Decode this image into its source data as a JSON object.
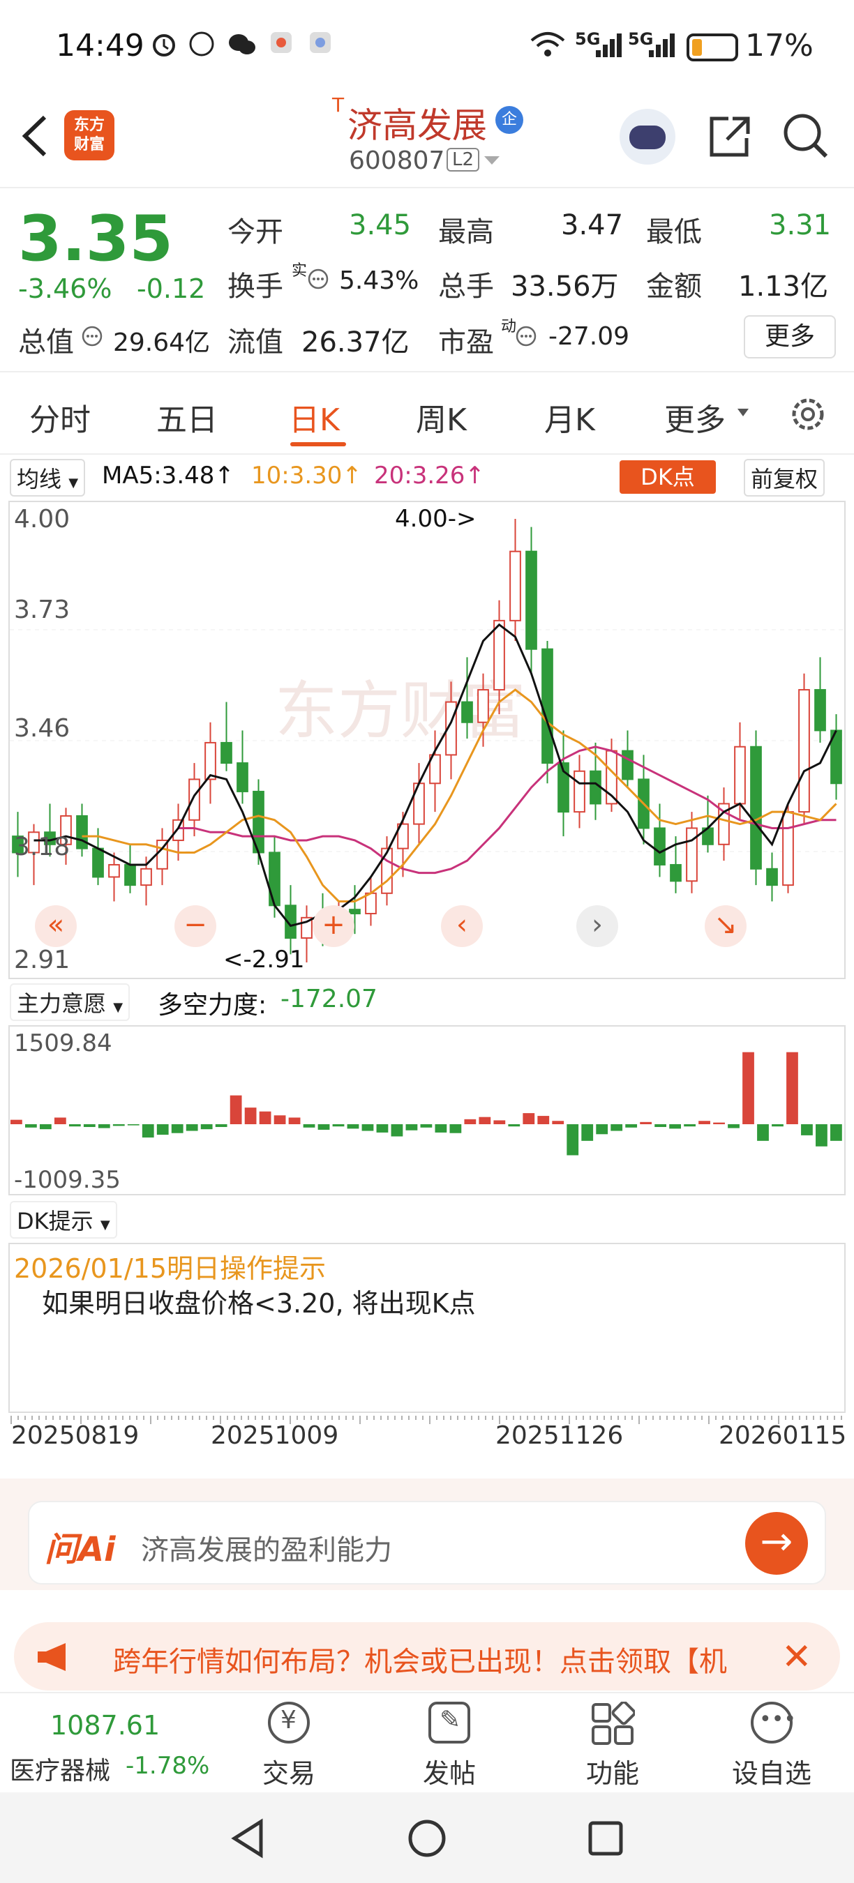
{
  "status_bar": {
    "time": "14:49",
    "battery": "17%",
    "net1": "5G",
    "net2": "5G"
  },
  "header": {
    "logo_line1": "东方",
    "logo_line2": "财富",
    "stock_name": "济高发展",
    "name_prefix": "T",
    "badge": "企",
    "code": "600807",
    "level": "L2"
  },
  "quote": {
    "price": "3.35",
    "change_pct": "-3.46%",
    "change_amt": "-0.12",
    "labels": {
      "open": "今开",
      "high": "最高",
      "low": "最低",
      "turnover": "换手",
      "turnover_sup": "实",
      "volume": "总手",
      "amount": "金额",
      "mktcap": "总值",
      "float": "流值",
      "pe": "市盈",
      "pe_sup": "动"
    },
    "values": {
      "open": "3.45",
      "high": "3.47",
      "low": "3.31",
      "turnover": "5.43%",
      "volume": "33.56万",
      "amount": "1.13亿",
      "mktcap": "29.64亿",
      "float": "26.37亿",
      "pe": "-27.09"
    },
    "more": "更多"
  },
  "tabs": [
    "分时",
    "五日",
    "日K",
    "周K",
    "月K",
    "更多"
  ],
  "active_tab": "日K",
  "ma_bar": {
    "selector": "均线",
    "ma5": "MA5:3.48↑",
    "ma10": "10:3.30↑",
    "ma20": "20:3.26↑",
    "dk": "DK点",
    "adj": "前复权"
  },
  "kline": {
    "y_ticks": [
      "4.00",
      "3.73",
      "3.46",
      "3.18",
      "2.91"
    ],
    "max_label": "4.00->",
    "min_label": "<-2.91",
    "watermark": "东方财富"
  },
  "sub_indicator": {
    "selector": "主力意愿",
    "label": "多空力度:",
    "value": "-172.07",
    "top": "1509.84",
    "bottom": "-1009.35"
  },
  "dk_hint": {
    "selector": "DK提示",
    "date_title": "2026/01/15明日操作提示",
    "text": "如果明日收盘价格<3.20, 将出现K点"
  },
  "dates": [
    "20250819",
    "20251009",
    "20251126",
    "20260115"
  ],
  "ai": {
    "logo": "问Ai",
    "placeholder": "济高发展的盈利能力"
  },
  "ad": {
    "text": "跨年行情如何布局？机会或已出现！点击领取【机"
  },
  "bottom_nav": {
    "index_value": "1087.61",
    "index_name": "医疗器械",
    "index_change": "-1.78%",
    "items": [
      "交易",
      "发帖",
      "功能",
      "设自选"
    ]
  },
  "colors": {
    "up": "#d9453a",
    "down": "#2f9a3a",
    "accent": "#e8541e",
    "ma5": "#111111",
    "ma10": "#e8961e",
    "ma20": "#c8327a"
  },
  "chart_data": {
    "type": "candlestick",
    "y_range": [
      2.91,
      4.0
    ],
    "ohlc": [
      [
        3.22,
        3.28,
        3.12,
        3.18
      ],
      [
        3.18,
        3.25,
        3.1,
        3.23
      ],
      [
        3.23,
        3.3,
        3.17,
        3.2
      ],
      [
        3.2,
        3.29,
        3.15,
        3.27
      ],
      [
        3.27,
        3.3,
        3.17,
        3.19
      ],
      [
        3.19,
        3.24,
        3.1,
        3.12
      ],
      [
        3.12,
        3.18,
        3.06,
        3.15
      ],
      [
        3.15,
        3.2,
        3.08,
        3.1
      ],
      [
        3.1,
        3.17,
        3.05,
        3.14
      ],
      [
        3.14,
        3.24,
        3.1,
        3.21
      ],
      [
        3.21,
        3.3,
        3.16,
        3.26
      ],
      [
        3.26,
        3.4,
        3.22,
        3.36
      ],
      [
        3.36,
        3.5,
        3.3,
        3.45
      ],
      [
        3.45,
        3.55,
        3.38,
        3.4
      ],
      [
        3.4,
        3.48,
        3.3,
        3.33
      ],
      [
        3.33,
        3.36,
        3.15,
        3.18
      ],
      [
        3.18,
        3.22,
        3.02,
        3.05
      ],
      [
        3.05,
        3.1,
        2.93,
        2.97
      ],
      [
        2.97,
        3.05,
        2.91,
        3.02
      ],
      [
        3.02,
        3.08,
        2.95,
        3.0
      ],
      [
        3.0,
        3.06,
        2.96,
        3.04
      ],
      [
        3.04,
        3.1,
        2.98,
        3.03
      ],
      [
        3.03,
        3.12,
        3.0,
        3.08
      ],
      [
        3.08,
        3.22,
        3.05,
        3.19
      ],
      [
        3.19,
        3.28,
        3.12,
        3.25
      ],
      [
        3.25,
        3.4,
        3.2,
        3.35
      ],
      [
        3.35,
        3.48,
        3.28,
        3.42
      ],
      [
        3.42,
        3.6,
        3.36,
        3.55
      ],
      [
        3.55,
        3.66,
        3.46,
        3.5
      ],
      [
        3.5,
        3.62,
        3.44,
        3.58
      ],
      [
        3.58,
        3.8,
        3.52,
        3.75
      ],
      [
        3.75,
        4.0,
        3.7,
        3.92
      ],
      [
        3.92,
        3.98,
        3.62,
        3.68
      ],
      [
        3.68,
        3.7,
        3.35,
        3.4
      ],
      [
        3.4,
        3.48,
        3.22,
        3.28
      ],
      [
        3.28,
        3.42,
        3.24,
        3.38
      ],
      [
        3.38,
        3.45,
        3.26,
        3.3
      ],
      [
        3.3,
        3.46,
        3.28,
        3.43
      ],
      [
        3.43,
        3.48,
        3.34,
        3.36
      ],
      [
        3.36,
        3.42,
        3.2,
        3.24
      ],
      [
        3.24,
        3.3,
        3.12,
        3.15
      ],
      [
        3.15,
        3.22,
        3.08,
        3.11
      ],
      [
        3.11,
        3.28,
        3.08,
        3.24
      ],
      [
        3.24,
        3.32,
        3.18,
        3.2
      ],
      [
        3.2,
        3.34,
        3.16,
        3.3
      ],
      [
        3.3,
        3.5,
        3.26,
        3.44
      ],
      [
        3.44,
        3.48,
        3.1,
        3.14
      ],
      [
        3.14,
        3.18,
        3.06,
        3.1
      ],
      [
        3.1,
        3.3,
        3.08,
        3.28
      ],
      [
        3.28,
        3.62,
        3.25,
        3.58
      ],
      [
        3.58,
        3.66,
        3.45,
        3.48
      ],
      [
        3.48,
        3.52,
        3.31,
        3.35
      ]
    ],
    "ma5": [
      3.21,
      3.21,
      3.22,
      3.21,
      3.19,
      3.17,
      3.15,
      3.15,
      3.19,
      3.24,
      3.32,
      3.37,
      3.36,
      3.28,
      3.18,
      3.05,
      3.0,
      3.01,
      3.03,
      3.04,
      3.07,
      3.12,
      3.18,
      3.26,
      3.35,
      3.43,
      3.5,
      3.6,
      3.7,
      3.74,
      3.71,
      3.62,
      3.5,
      3.38,
      3.35,
      3.35,
      3.32,
      3.28,
      3.21,
      3.18,
      3.2,
      3.21,
      3.24,
      3.28,
      3.3,
      3.25,
      3.2,
      3.3,
      3.38,
      3.4,
      3.48
    ],
    "ma10": [
      3.22,
      3.22,
      3.21,
      3.2,
      3.2,
      3.19,
      3.18,
      3.18,
      3.2,
      3.23,
      3.26,
      3.27,
      3.26,
      3.23,
      3.17,
      3.1,
      3.06,
      3.06,
      3.08,
      3.11,
      3.15,
      3.2,
      3.25,
      3.32,
      3.4,
      3.48,
      3.55,
      3.58,
      3.55,
      3.5,
      3.47,
      3.45,
      3.42,
      3.38,
      3.34,
      3.3,
      3.26,
      3.25,
      3.26,
      3.27,
      3.26,
      3.25,
      3.26,
      3.28,
      3.28,
      3.27,
      3.26,
      3.3
    ],
    "ma20": [
      3.24,
      3.24,
      3.23,
      3.23,
      3.22,
      3.22,
      3.22,
      3.21,
      3.21,
      3.22,
      3.22,
      3.21,
      3.19,
      3.16,
      3.14,
      3.13,
      3.13,
      3.14,
      3.16,
      3.2,
      3.24,
      3.29,
      3.34,
      3.38,
      3.41,
      3.43,
      3.44,
      3.43,
      3.41,
      3.39,
      3.37,
      3.35,
      3.33,
      3.31,
      3.28,
      3.26,
      3.25,
      3.24,
      3.24,
      3.25,
      3.26,
      3.26
    ],
    "flow": [
      80,
      -60,
      -90,
      120,
      -40,
      -50,
      -70,
      -30,
      -20,
      -240,
      -190,
      -160,
      -120,
      -90,
      -50,
      520,
      300,
      230,
      160,
      120,
      -60,
      -100,
      -40,
      -80,
      -120,
      -150,
      -220,
      -110,
      -60,
      -150,
      -160,
      90,
      130,
      70,
      -40,
      200,
      150,
      60,
      -560,
      -300,
      -180,
      -120,
      -60,
      40,
      -50,
      -80,
      -40,
      60,
      30,
      -70,
      1300,
      -300,
      -40,
      1300,
      -200,
      -400,
      -300
    ]
  }
}
